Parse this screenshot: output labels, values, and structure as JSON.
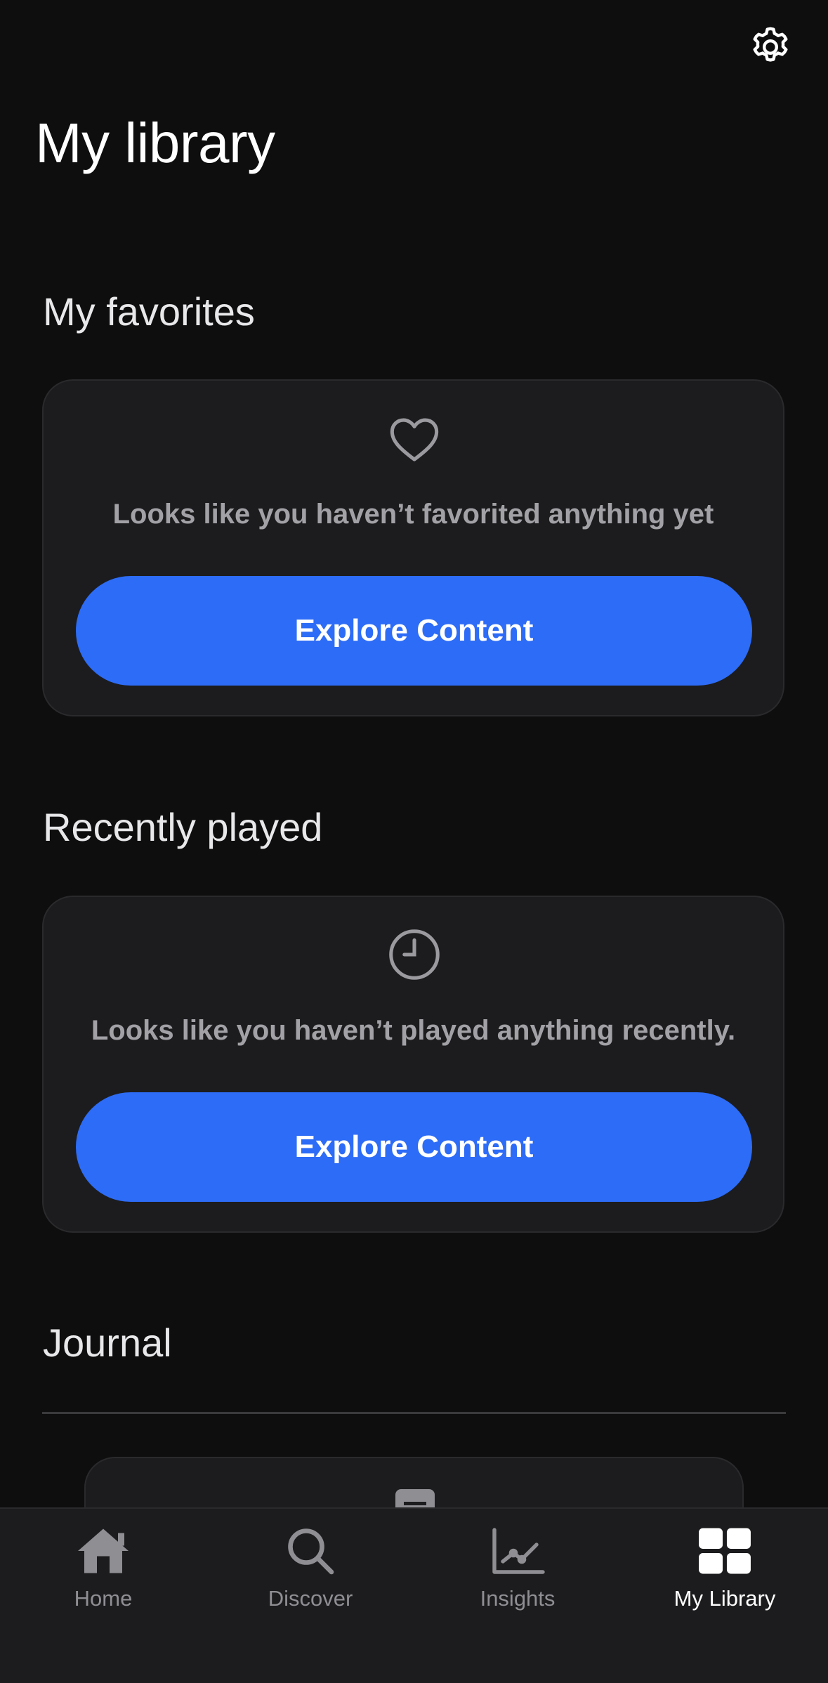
{
  "header": {
    "title": "My library",
    "settings_icon": "gear-icon"
  },
  "favorites": {
    "title": "My favorites",
    "icon": "heart-icon",
    "empty_text": "Looks like you haven’t favorited anything yet",
    "button_label": "Explore Content"
  },
  "recent": {
    "title": "Recently played",
    "icon": "clock-icon",
    "empty_text": "Looks like you haven’t played anything recently.",
    "button_label": "Explore Content"
  },
  "journal": {
    "title": "Journal",
    "icon": "journal-icon"
  },
  "tabs": [
    {
      "label": "Home",
      "icon": "home-icon",
      "active": false
    },
    {
      "label": "Discover",
      "icon": "search-icon",
      "active": false
    },
    {
      "label": "Insights",
      "icon": "chart-icon",
      "active": false
    },
    {
      "label": "My Library",
      "icon": "grid-icon",
      "active": true
    }
  ],
  "colors": {
    "background": "#0e0e0f",
    "card": "#1c1c1e",
    "accent": "#2d6cf6",
    "muted_text": "#a1a1a6",
    "inactive_tab": "#8e8e93"
  }
}
